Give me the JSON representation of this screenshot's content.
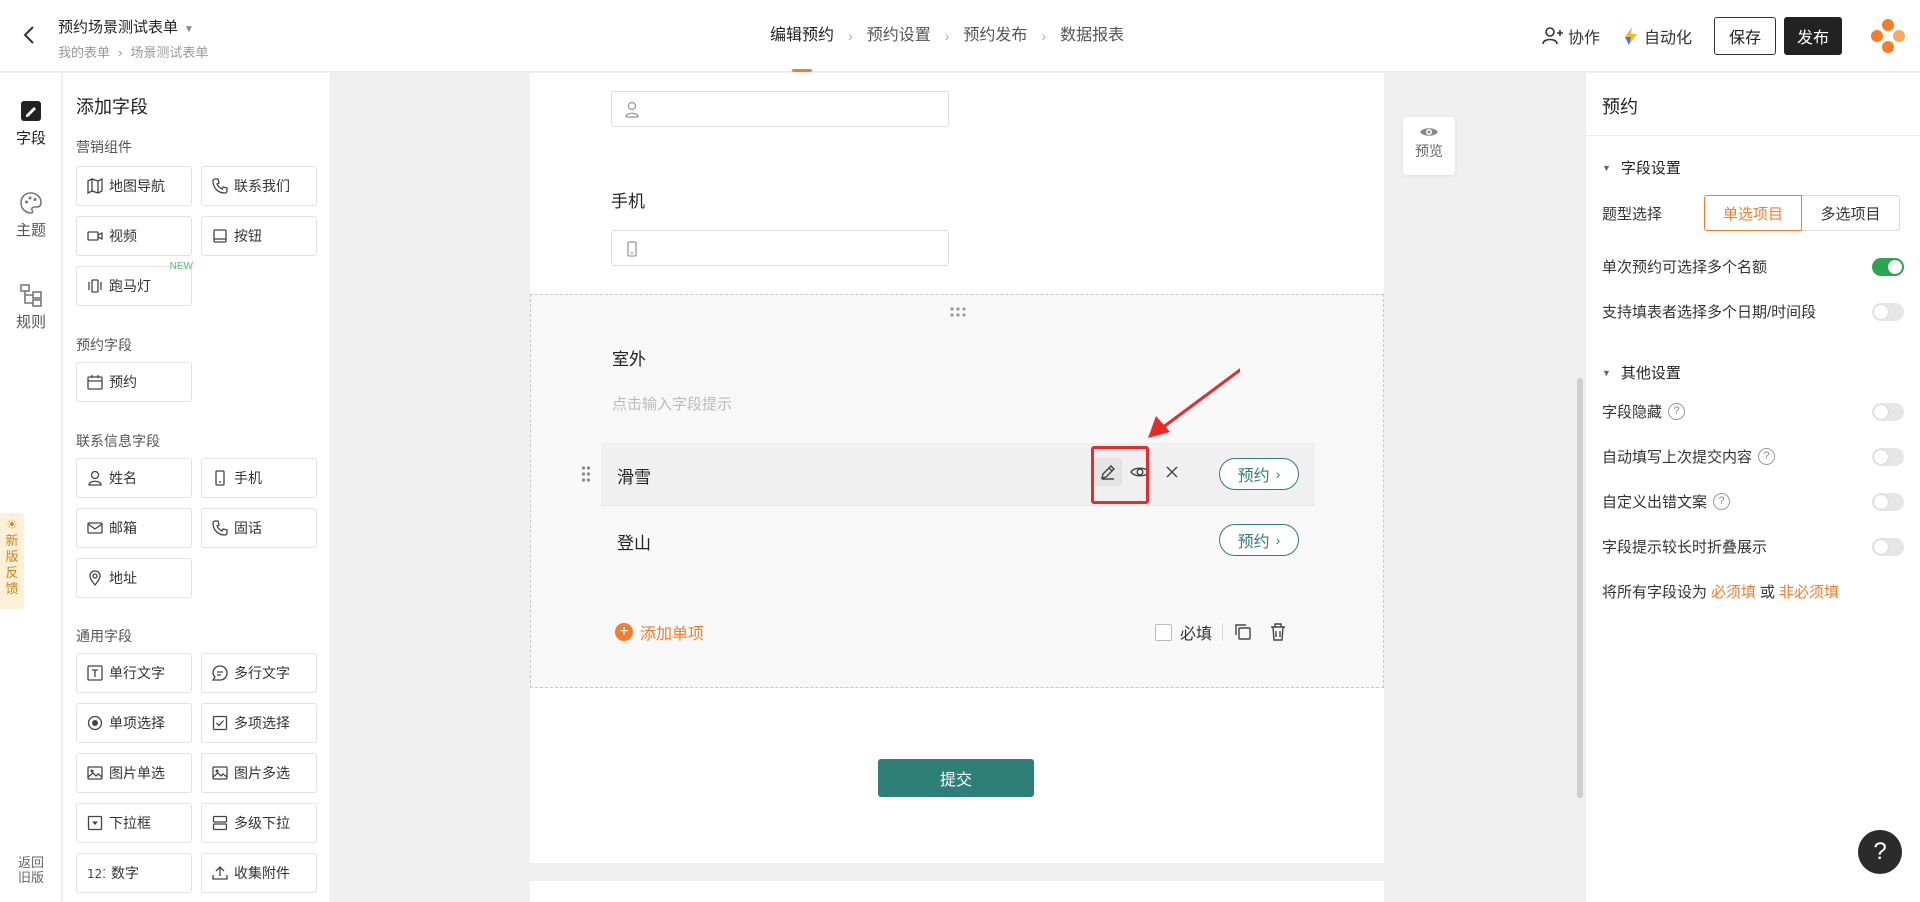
{
  "header": {
    "form_title": "预约场景测试表单",
    "breadcrumb": [
      "我的表单",
      "场景测试表单"
    ],
    "steps": [
      "编辑预约",
      "预约设置",
      "预约发布",
      "数据报表"
    ],
    "collab": "协作",
    "automation": "自动化",
    "save": "保存",
    "publish": "发布"
  },
  "rail": {
    "fields": "字段",
    "theme": "主题",
    "rules": "规则",
    "feedback": [
      "新",
      "版",
      "反",
      "馈"
    ],
    "back_old": [
      "返回",
      "旧版"
    ]
  },
  "fields_panel": {
    "title": "添加字段",
    "groups": {
      "marketing": "营销组件",
      "booking": "预约字段",
      "contact": "联系信息字段",
      "general": "通用字段"
    },
    "items": {
      "map_nav": "地图导航",
      "contact_us": "联系我们",
      "video": "视频",
      "button": "按钮",
      "marquee": "跑马灯",
      "marquee_badge": "NEW",
      "booking": "预约",
      "name": "姓名",
      "mobile": "手机",
      "email": "邮箱",
      "phone": "固话",
      "address": "地址",
      "single_text": "单行文字",
      "multi_text": "多行文字",
      "single_choice": "单项选择",
      "multi_choice": "多项选择",
      "image_single": "图片单选",
      "image_multi": "图片多选",
      "dropdown": "下拉框",
      "cascade": "多级下拉",
      "number": "数字",
      "attachment": "收集附件"
    }
  },
  "canvas": {
    "mobile_label": "手机",
    "field_label": "室外",
    "field_hint": "点击输入字段提示",
    "options": [
      {
        "name": "滑雪",
        "action": "预约"
      },
      {
        "name": "登山",
        "action": "预约"
      }
    ],
    "add_item": "添加单项",
    "required": "必填",
    "submit": "提交",
    "preview": "预览"
  },
  "settings": {
    "title": "预约",
    "field_settings": "字段设置",
    "type_select": "题型选择",
    "single": "单选项目",
    "multi": "多选项目",
    "multi_quota": "单次预约可选择多个名额",
    "multi_dates": "支持填表者选择多个日期/时间段",
    "other_settings": "其他设置",
    "hide_field": "字段隐藏",
    "autofill": "自动填写上次提交内容",
    "custom_error": "自定义出错文案",
    "fold_hint": "字段提示较长时折叠展示",
    "set_all_prefix": "将所有字段设为",
    "required": "必须填",
    "or": "或",
    "optional": "非必须填"
  },
  "colors": {
    "accent": "#f47c2c",
    "teal": "#2e7f78",
    "toggle_on": "#2ea44f",
    "highlight": "#e82a2a"
  }
}
